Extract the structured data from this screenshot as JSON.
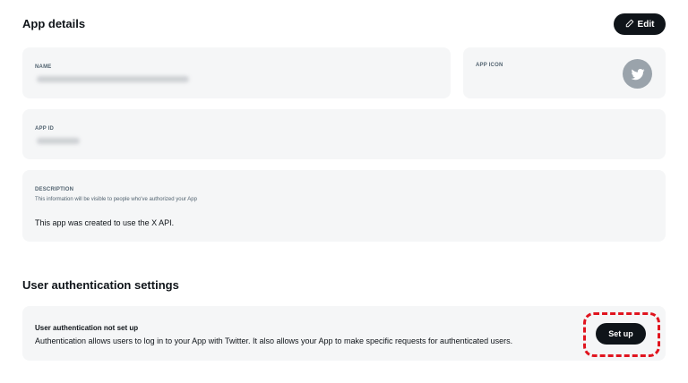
{
  "app_details": {
    "title": "App details",
    "edit_label": "Edit",
    "name": {
      "label": "NAME"
    },
    "app_icon": {
      "label": "APP ICON"
    },
    "app_id": {
      "label": "APP ID"
    },
    "description": {
      "label": "DESCRIPTION",
      "helper": "This information will be visible to people who've authorized your App",
      "value": "This app was created to use the X API."
    }
  },
  "user_auth": {
    "title": "User authentication settings",
    "heading": "User authentication not set up",
    "body": "Authentication allows users to log in to your App with Twitter. It also allows your App to make specific requests for authenticated users.",
    "setup_label": "Set up"
  },
  "icons": {
    "edit": "pencil-icon",
    "app_icon": "twitter-bird-icon"
  },
  "colors": {
    "button_bg": "#0f1419",
    "card_bg": "#f5f6f7",
    "highlight": "#e0141e"
  }
}
